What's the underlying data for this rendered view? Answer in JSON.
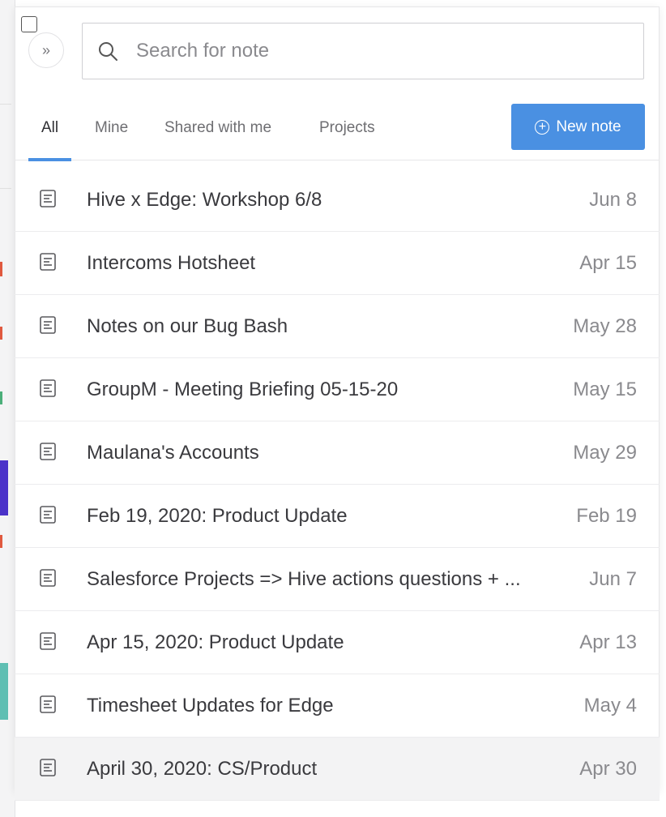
{
  "search": {
    "placeholder": "Search for note",
    "value": ""
  },
  "tabs": [
    {
      "label": "All",
      "active": true
    },
    {
      "label": "Mine",
      "active": false
    },
    {
      "label": "Shared with me",
      "active": false
    },
    {
      "label": "Projects",
      "active": false
    }
  ],
  "new_note": {
    "label": "New note",
    "icon": "plus-circle-icon"
  },
  "expand": {
    "icon": "double-chevron-right-icon",
    "glyph": "»"
  },
  "notes": [
    {
      "title": "Hive x Edge: Workshop 6/8",
      "date": "Jun 8"
    },
    {
      "title": "Intercoms Hotsheet",
      "date": "Apr 15"
    },
    {
      "title": "Notes on our Bug Bash",
      "date": "May 28"
    },
    {
      "title": "GroupM - Meeting Briefing 05-15-20",
      "date": "May 15"
    },
    {
      "title": "Maulana's Accounts",
      "date": "May 29"
    },
    {
      "title": "Feb 19, 2020: Product Update",
      "date": "Feb 19"
    },
    {
      "title": "Salesforce Projects => Hive actions questions + ...",
      "date": "Jun 7"
    },
    {
      "title": "Apr 15, 2020: Product Update",
      "date": "Apr 13"
    },
    {
      "title": "Timesheet Updates for Edge",
      "date": "May 4"
    },
    {
      "title": "April 30, 2020: CS/Product",
      "date": "Apr 30"
    }
  ],
  "colors": {
    "accent": "#4a90e2",
    "hover_row": "#f3f3f4"
  }
}
